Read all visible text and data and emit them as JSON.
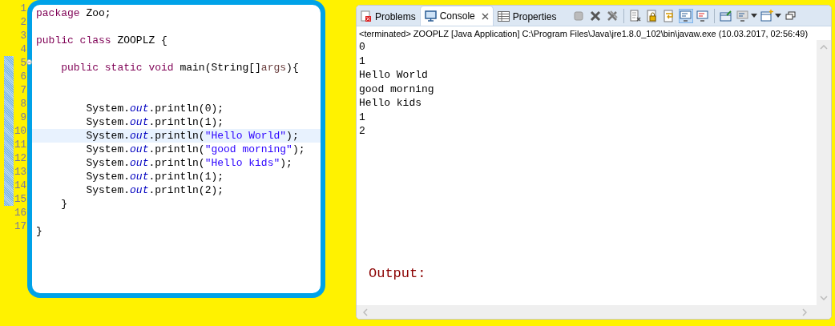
{
  "editor": {
    "lines": [
      {
        "number": "1",
        "marked": false,
        "current": false,
        "fold": false,
        "tokens": [
          {
            "kind": "kw",
            "text": "package"
          },
          {
            "kind": "plain",
            "text": " Zoo;"
          }
        ]
      },
      {
        "number": "2",
        "marked": false,
        "current": false,
        "fold": false
      },
      {
        "number": "3",
        "marked": false,
        "current": false,
        "fold": false,
        "tokens": [
          {
            "kind": "kw",
            "text": "public"
          },
          {
            "kind": "kw",
            "text": " class"
          },
          {
            "kind": "plain",
            "text": " ZOOPLZ {"
          }
        ]
      },
      {
        "number": "4",
        "marked": false,
        "current": false,
        "fold": false
      },
      {
        "number": "5",
        "marked": true,
        "current": false,
        "fold": true,
        "tokens": [
          {
            "kind": "kw",
            "text": "    public"
          },
          {
            "kind": "kw",
            "text": " static"
          },
          {
            "kind": "kw",
            "text": " void"
          },
          {
            "kind": "plain",
            "text": " main(String[]"
          },
          {
            "kind": "param",
            "text": "args"
          },
          {
            "kind": "plain",
            "text": "){"
          }
        ]
      },
      {
        "number": "6",
        "marked": true,
        "current": false,
        "fold": false
      },
      {
        "number": "7",
        "marked": true,
        "current": false,
        "fold": false
      },
      {
        "number": "8",
        "marked": true,
        "current": false,
        "fold": false,
        "tokens": [
          {
            "kind": "plain",
            "text": "        System."
          },
          {
            "kind": "field",
            "text": "out"
          },
          {
            "kind": "plain",
            "text": ".println(0);"
          }
        ]
      },
      {
        "number": "9",
        "marked": true,
        "current": false,
        "fold": false,
        "tokens": [
          {
            "kind": "plain",
            "text": "        System."
          },
          {
            "kind": "field",
            "text": "out"
          },
          {
            "kind": "plain",
            "text": ".println(1);"
          }
        ]
      },
      {
        "number": "10",
        "marked": true,
        "current": true,
        "fold": false,
        "tokens": [
          {
            "kind": "plain",
            "text": "        System."
          },
          {
            "kind": "field",
            "text": "out"
          },
          {
            "kind": "plain",
            "text": ".println("
          },
          {
            "kind": "str",
            "text": "\"Hello World\""
          },
          {
            "kind": "plain",
            "text": ");"
          }
        ]
      },
      {
        "number": "11",
        "marked": true,
        "current": false,
        "fold": false,
        "tokens": [
          {
            "kind": "plain",
            "text": "        System."
          },
          {
            "kind": "field",
            "text": "out"
          },
          {
            "kind": "plain",
            "text": ".println("
          },
          {
            "kind": "str",
            "text": "\"good morning\""
          },
          {
            "kind": "plain",
            "text": ");"
          }
        ]
      },
      {
        "number": "12",
        "marked": true,
        "current": false,
        "fold": false,
        "tokens": [
          {
            "kind": "plain",
            "text": "        System."
          },
          {
            "kind": "field",
            "text": "out"
          },
          {
            "kind": "plain",
            "text": ".println("
          },
          {
            "kind": "str",
            "text": "\"Hello kids\""
          },
          {
            "kind": "plain",
            "text": ");"
          }
        ]
      },
      {
        "number": "13",
        "marked": true,
        "current": false,
        "fold": false,
        "tokens": [
          {
            "kind": "plain",
            "text": "        System."
          },
          {
            "kind": "field",
            "text": "out"
          },
          {
            "kind": "plain",
            "text": ".println(1);"
          }
        ]
      },
      {
        "number": "14",
        "marked": true,
        "current": false,
        "fold": false,
        "tokens": [
          {
            "kind": "plain",
            "text": "        System."
          },
          {
            "kind": "field",
            "text": "out"
          },
          {
            "kind": "plain",
            "text": ".println(2);"
          }
        ]
      },
      {
        "number": "15",
        "marked": true,
        "current": false,
        "fold": false,
        "tokens": [
          {
            "kind": "plain",
            "text": "    }"
          }
        ]
      },
      {
        "number": "16",
        "marked": false,
        "current": false,
        "fold": false
      },
      {
        "number": "17",
        "marked": false,
        "current": false,
        "fold": false,
        "tokens": [
          {
            "kind": "plain",
            "text": "}"
          }
        ]
      }
    ]
  },
  "console_view": {
    "tabs": [
      {
        "label": "Problems",
        "selected": false,
        "closable": false
      },
      {
        "label": "Console",
        "selected": true,
        "closable": true
      },
      {
        "label": "Properties",
        "selected": false,
        "closable": false
      }
    ],
    "toolbar": [
      {
        "kind": "stop",
        "pressed": false
      },
      {
        "kind": "remove",
        "pressed": false
      },
      {
        "kind": "remove-all",
        "pressed": false
      },
      {
        "kind": "separator"
      },
      {
        "kind": "clear",
        "pressed": false
      },
      {
        "kind": "lock",
        "pressed": false
      },
      {
        "kind": "wrap",
        "pressed": false
      },
      {
        "kind": "stdout",
        "pressed": true
      },
      {
        "kind": "stderr",
        "pressed": false
      },
      {
        "kind": "separator"
      },
      {
        "kind": "pin",
        "pressed": false
      },
      {
        "kind": "display",
        "pressed": false
      },
      {
        "kind": "dropdown"
      },
      {
        "kind": "new-console",
        "pressed": false
      },
      {
        "kind": "dropdown"
      },
      {
        "kind": "minimize",
        "pressed": false
      }
    ],
    "status": "<terminated> ZOOPLZ [Java Application] C:\\Program Files\\Java\\jre1.8.0_102\\bin\\javaw.exe (10.03.2017, 02:56:49)",
    "output": [
      "0",
      "1",
      "Hello World",
      "good morning",
      "Hello kids",
      "1",
      "2"
    ],
    "annotation": "Output:"
  }
}
